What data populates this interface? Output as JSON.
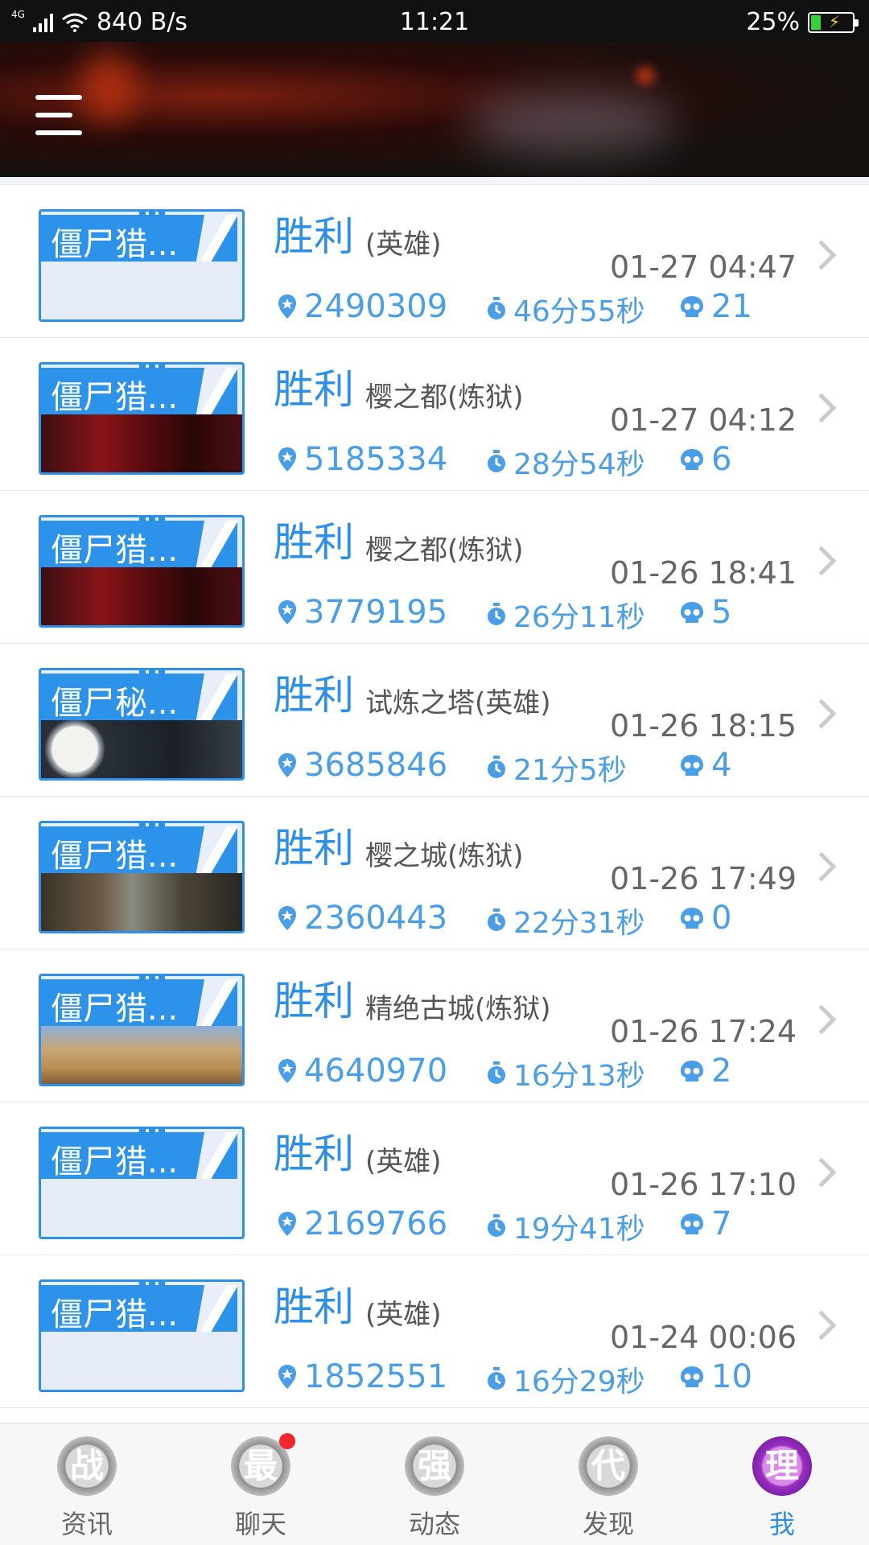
{
  "status_bar": {
    "network": "4G",
    "speed": "840 B/s",
    "time": "11:21",
    "battery": "25%"
  },
  "records": [
    {
      "title": "僵尸猎...",
      "result": "胜利",
      "mode": "(英雄)",
      "datetime": "01-27 04:47",
      "score": "2490309",
      "duration": "46分55秒",
      "kills": "21",
      "image": "blank"
    },
    {
      "title": "僵尸猎...",
      "result": "胜利",
      "mode": "樱之都(炼狱)",
      "datetime": "01-27 04:12",
      "score": "5185334",
      "duration": "28分54秒",
      "kills": "6",
      "image": "red"
    },
    {
      "title": "僵尸猎...",
      "result": "胜利",
      "mode": "樱之都(炼狱)",
      "datetime": "01-26 18:41",
      "score": "3779195",
      "duration": "26分11秒",
      "kills": "5",
      "image": "red"
    },
    {
      "title": "僵尸秘...",
      "result": "胜利",
      "mode": "试炼之塔(英雄)",
      "datetime": "01-26 18:15",
      "score": "3685846",
      "duration": "21分5秒",
      "kills": "4",
      "image": "moon"
    },
    {
      "title": "僵尸猎...",
      "result": "胜利",
      "mode": "樱之城(炼狱)",
      "datetime": "01-26 17:49",
      "score": "2360443",
      "duration": "22分31秒",
      "kills": "0",
      "image": "fight"
    },
    {
      "title": "僵尸猎...",
      "result": "胜利",
      "mode": "精绝古城(炼狱)",
      "datetime": "01-26 17:24",
      "score": "4640970",
      "duration": "16分13秒",
      "kills": "2",
      "image": "desert"
    },
    {
      "title": "僵尸猎...",
      "result": "胜利",
      "mode": "(英雄)",
      "datetime": "01-26 17:10",
      "score": "2169766",
      "duration": "19分41秒",
      "kills": "7",
      "image": "blank"
    },
    {
      "title": "僵尸猎...",
      "result": "胜利",
      "mode": "(英雄)",
      "datetime": "01-24 00:06",
      "score": "1852551",
      "duration": "16分29秒",
      "kills": "10",
      "image": "blank"
    }
  ],
  "bottom_nav": [
    {
      "badge": "战",
      "label": "资讯",
      "active": false,
      "dot": false
    },
    {
      "badge": "最",
      "label": "聊天",
      "active": false,
      "dot": true
    },
    {
      "badge": "强",
      "label": "动态",
      "active": false,
      "dot": false
    },
    {
      "badge": "代",
      "label": "发现",
      "active": false,
      "dot": false
    },
    {
      "badge": "理",
      "label": "我",
      "active": true,
      "dot": false
    }
  ],
  "colors": {
    "accent": "#2d8fe6",
    "stat": "#4a9ee8",
    "nav_active": "#2d8fe6",
    "notification": "#f2262c"
  }
}
